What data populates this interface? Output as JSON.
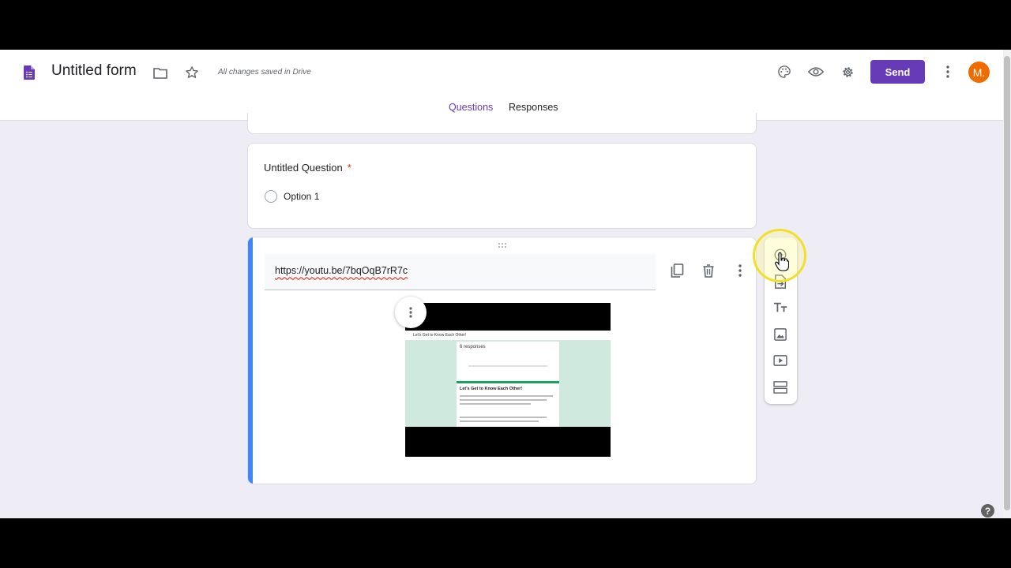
{
  "header": {
    "title": "Untitled form",
    "saved_status": "All changes saved in Drive",
    "send_label": "Send",
    "avatar_letter": "M."
  },
  "tabs": [
    {
      "label": "Questions",
      "active": true
    },
    {
      "label": "Responses",
      "active": false
    }
  ],
  "question": {
    "title": "Untitled Question",
    "required_mark": "*",
    "option": "Option 1"
  },
  "video_item": {
    "url": "https://youtu.be/7bqOqB7rR7c",
    "thumbnail": {
      "tab_title": "Let's Get to Know Each Other!",
      "responses": "6 responses",
      "form_heading": "Let's Get to Know Each Other!"
    }
  },
  "side_toolbar": [
    "add-question-icon",
    "import-questions-icon",
    "add-title-icon",
    "add-image-icon",
    "add-video-icon",
    "add-section-icon"
  ],
  "help_label": "?",
  "colors": {
    "accent": "#673ab7",
    "avatar": "#ef6c00",
    "active_card_bar": "#4285f4",
    "required": "#d93025",
    "background": "#eeedf5"
  }
}
